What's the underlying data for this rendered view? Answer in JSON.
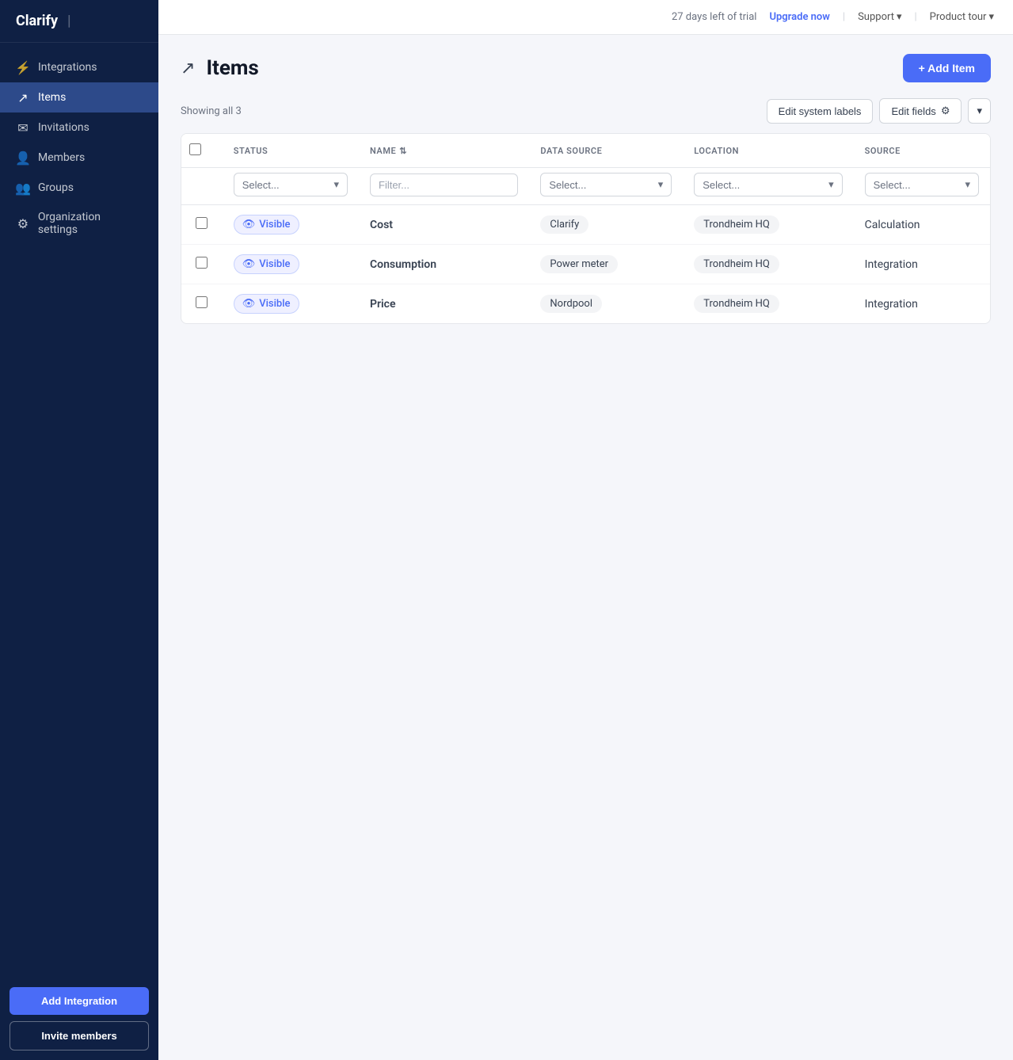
{
  "app": {
    "name": "Clarify"
  },
  "topbar": {
    "trial_text": "27 days left of trial",
    "upgrade_label": "Upgrade now",
    "support_label": "Support",
    "product_tour_label": "Product tour"
  },
  "sidebar": {
    "items": [
      {
        "id": "integrations",
        "label": "Integrations",
        "icon": "⚡",
        "active": false
      },
      {
        "id": "items",
        "label": "Items",
        "icon": "↗",
        "active": true
      },
      {
        "id": "invitations",
        "label": "Invitations",
        "icon": "✉",
        "active": false
      },
      {
        "id": "members",
        "label": "Members",
        "icon": "👤",
        "active": false
      },
      {
        "id": "groups",
        "label": "Groups",
        "icon": "👥",
        "active": false
      },
      {
        "id": "org-settings",
        "label": "Organization settings",
        "icon": "⚙",
        "active": false
      }
    ],
    "add_integration_label": "Add Integration",
    "invite_members_label": "Invite members"
  },
  "page": {
    "title": "Items",
    "add_item_label": "+ Add Item",
    "showing_label": "Showing all 3",
    "edit_system_labels": "Edit system labels",
    "edit_fields_label": "Edit fields"
  },
  "table": {
    "columns": [
      {
        "id": "status",
        "label": "STATUS",
        "filter_placeholder": "Select..."
      },
      {
        "id": "name",
        "label": "NAME",
        "filter_placeholder": "Filter...",
        "sortable": true
      },
      {
        "id": "datasource",
        "label": "DATA SOURCE",
        "filter_placeholder": "Select..."
      },
      {
        "id": "location",
        "label": "LOCATION",
        "filter_placeholder": "Select..."
      },
      {
        "id": "source",
        "label": "SOURCE",
        "filter_placeholder": "Select..."
      }
    ],
    "rows": [
      {
        "status": "Visible",
        "name": "Cost",
        "datasource": "Clarify",
        "location": "Trondheim HQ",
        "source": "Calculation"
      },
      {
        "status": "Visible",
        "name": "Consumption",
        "datasource": "Power meter",
        "location": "Trondheim HQ",
        "source": "Integration"
      },
      {
        "status": "Visible",
        "name": "Price",
        "datasource": "Nordpool",
        "location": "Trondheim HQ",
        "source": "Integration"
      }
    ]
  }
}
